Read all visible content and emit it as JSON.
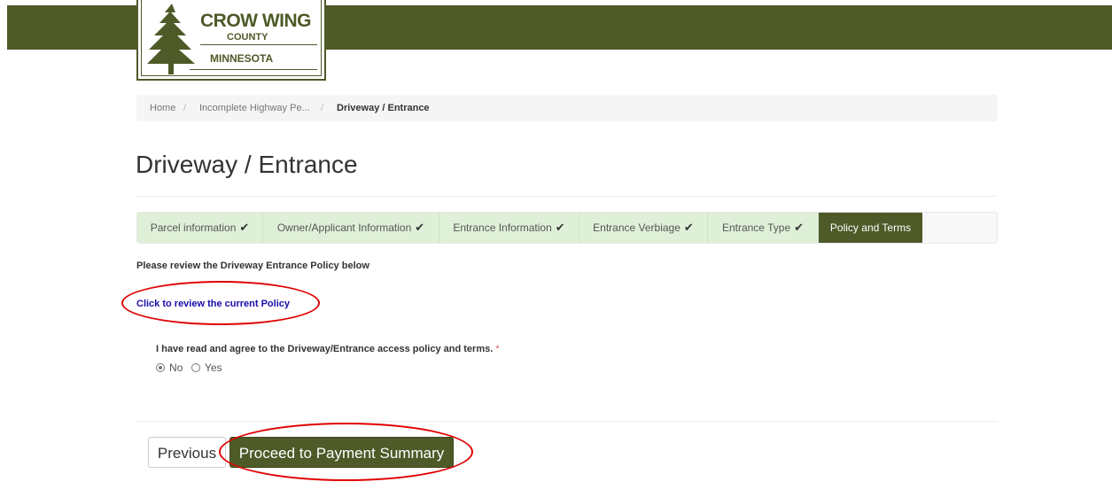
{
  "header": {
    "logo": {
      "line1": "CROW WING",
      "line2": "COUNTY",
      "line3": "MINNESOTA"
    }
  },
  "breadcrumb": {
    "home": "Home",
    "separator": "/",
    "parent": "Incomplete Highway Pe...",
    "current": "Driveway / Entrance"
  },
  "page": {
    "title": "Driveway / Entrance"
  },
  "steps": [
    {
      "label": "Parcel information",
      "done": "✔"
    },
    {
      "label": "Owner/Applicant Information",
      "done": "✔"
    },
    {
      "label": "Entrance Information",
      "done": "✔"
    },
    {
      "label": "Entrance Verbiage",
      "done": "✔"
    },
    {
      "label": "Entrance Type",
      "done": "✔"
    },
    {
      "label": "Policy and Terms",
      "done": ""
    }
  ],
  "policy": {
    "intro": "Please review the Driveway Entrance Policy below",
    "link": "Click to review the current Policy"
  },
  "agreement": {
    "question": "I have read and agree to the Driveway/Entrance access policy and terms.",
    "required_marker": "*",
    "options": [
      "No",
      "Yes"
    ],
    "selected": "No"
  },
  "buttons": {
    "previous": "Previous",
    "proceed": "Proceed to Payment Summary"
  },
  "colors": {
    "brand": "#4e5a28",
    "step_done": "#dff0d8",
    "link": "#1a0dab",
    "required": "#d9534f",
    "annotation": "#e00000"
  }
}
